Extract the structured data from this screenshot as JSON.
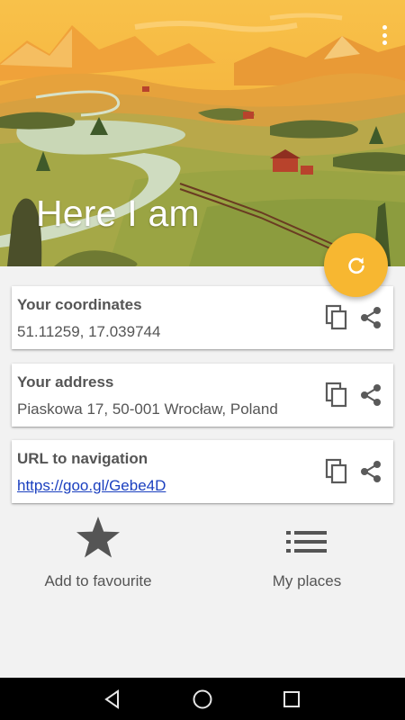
{
  "header": {
    "title": "Here I am",
    "menu_icon": "more-vert-icon"
  },
  "refresh_button": {
    "icon": "refresh-icon",
    "color": "#f7b731"
  },
  "cards": [
    {
      "title": "Your coordinates",
      "value": "51.11259, 17.039744",
      "copy_icon": "copy-icon",
      "share_icon": "share-icon"
    },
    {
      "title": "Your address",
      "value": "Piaskowa 17, 50-001 Wrocław, Poland",
      "copy_icon": "copy-icon",
      "share_icon": "share-icon"
    },
    {
      "title": "URL to navigation",
      "value": "https://goo.gl/Gebe4D",
      "copy_icon": "copy-icon",
      "share_icon": "share-icon"
    }
  ],
  "actions": {
    "favourite": {
      "label": "Add to favourite",
      "icon": "star-icon"
    },
    "places": {
      "label": "My places",
      "icon": "list-icon"
    }
  },
  "navbar": {
    "back_icon": "back-icon",
    "home_icon": "home-icon",
    "recents_icon": "recents-icon"
  },
  "colors": {
    "accent": "#f7b731",
    "text": "#555555",
    "link": "#1a3fbf",
    "background": "#f2f2f2"
  }
}
